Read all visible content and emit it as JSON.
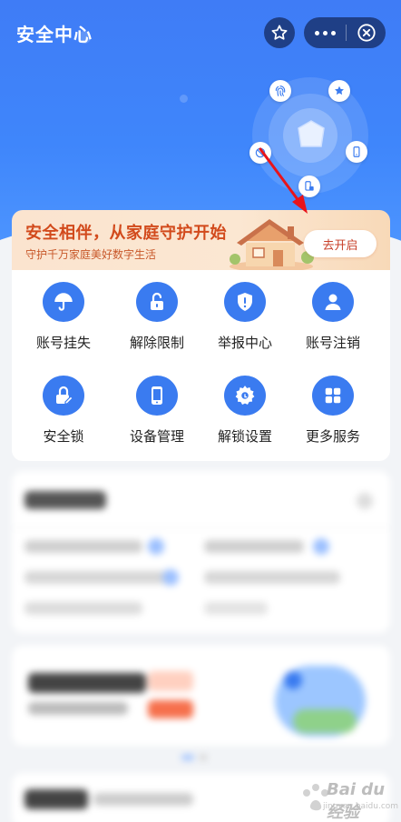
{
  "header": {
    "title": "安全中心"
  },
  "banner": {
    "title": "安全相伴，从家庭守护开始",
    "subtitle": "守护千万家庭美好数字生活",
    "button_label": "去开启"
  },
  "services": [
    {
      "label": "账号挂失",
      "icon": "umbrella-icon"
    },
    {
      "label": "解除限制",
      "icon": "unlock-icon"
    },
    {
      "label": "举报中心",
      "icon": "report-shield-icon"
    },
    {
      "label": "账号注销",
      "icon": "user-icon"
    },
    {
      "label": "安全锁",
      "icon": "lock-edit-icon"
    },
    {
      "label": "设备管理",
      "icon": "phone-icon"
    },
    {
      "label": "解锁设置",
      "icon": "gear-icon"
    },
    {
      "label": "更多服务",
      "icon": "grid-icon"
    }
  ],
  "watermark": {
    "text": "Bai du 经验",
    "url_text": "jingyan.baidu.com"
  },
  "colors": {
    "hero_blue": "#3f86fb",
    "icon_blue": "#3a7bf0",
    "banner_orange": "#d24a1c",
    "arrow_red": "#e8141b"
  }
}
